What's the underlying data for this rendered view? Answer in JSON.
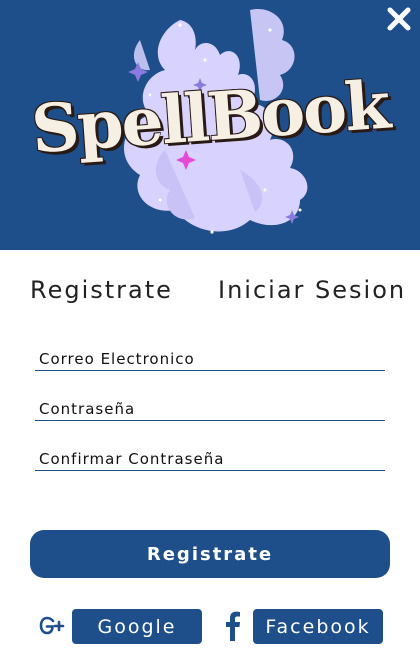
{
  "header": {
    "logo_text": "SpellBook",
    "close_icon": "close-icon",
    "colors": {
      "banner": "#1e4f8a",
      "smoke": "#d8d2ff",
      "logo_fill": "#f6efe3"
    }
  },
  "tabs": {
    "register_label": "Registrate",
    "login_label": "Iniciar Sesion"
  },
  "form": {
    "email_placeholder": "Correo Electronico",
    "password_placeholder": "Contraseña",
    "confirm_placeholder": "Confirmar Contraseña"
  },
  "primary_button": {
    "label": "Registrate"
  },
  "social": {
    "google_icon": "google-plus-icon",
    "google_label": "Google",
    "facebook_icon": "facebook-icon",
    "facebook_label": "Facebook"
  },
  "colors": {
    "accent": "#1e4f8a"
  }
}
